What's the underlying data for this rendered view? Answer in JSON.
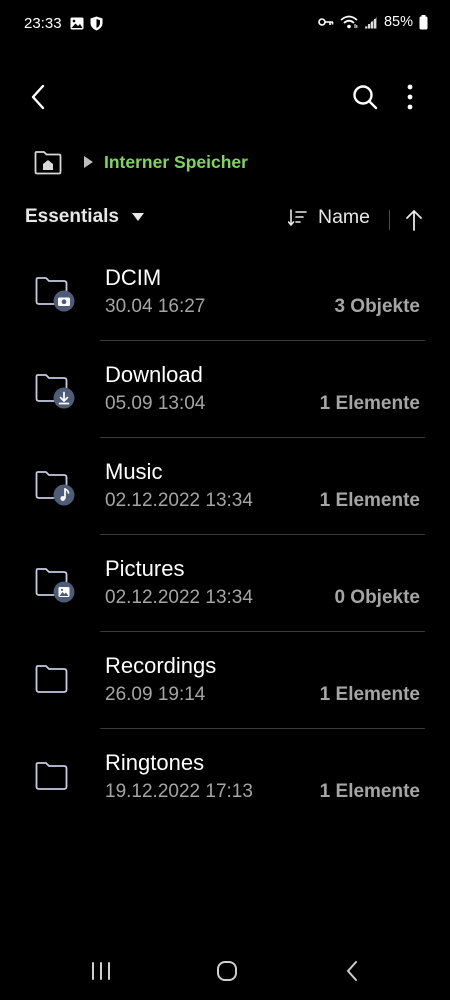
{
  "status_bar": {
    "time": "23:33",
    "battery": "85%",
    "left_icons": [
      "image-icon",
      "shield-icon"
    ],
    "right_icons": [
      "key-icon",
      "wifi-icon",
      "signal-icon",
      "battery-icon"
    ]
  },
  "app_bar": {
    "icons": [
      "back-arrow-icon",
      "search-icon",
      "more-vertical-icon"
    ]
  },
  "breadcrumb": {
    "home_icon": "home-icon",
    "location": "Interner Speicher",
    "accent_color": "#80d264"
  },
  "sort_bar": {
    "filter_label": "Essentials",
    "sort_label": "Name",
    "sort_direction_icon": "arrow-up-icon"
  },
  "files": [
    {
      "name": "DCIM",
      "date": "30.04 16:27",
      "count": "3 Objekte",
      "badge": "camera-icon"
    },
    {
      "name": "Download",
      "date": "05.09 13:04",
      "count": "1 Elemente",
      "badge": "download-icon"
    },
    {
      "name": "Music",
      "date": "02.12.2022 13:34",
      "count": "1 Elemente",
      "badge": "music-note-icon"
    },
    {
      "name": "Pictures",
      "date": "02.12.2022 13:34",
      "count": "0 Objekte",
      "badge": "image-icon"
    },
    {
      "name": "Recordings",
      "date": "26.09 19:14",
      "count": "1 Elemente",
      "badge": ""
    },
    {
      "name": "Ringtones",
      "date": "19.12.2022 17:13",
      "count": "1 Elemente",
      "badge": ""
    }
  ],
  "nav_bar": {
    "icons": [
      "recents-icon",
      "home-circle-icon",
      "nav-back-icon"
    ]
  }
}
